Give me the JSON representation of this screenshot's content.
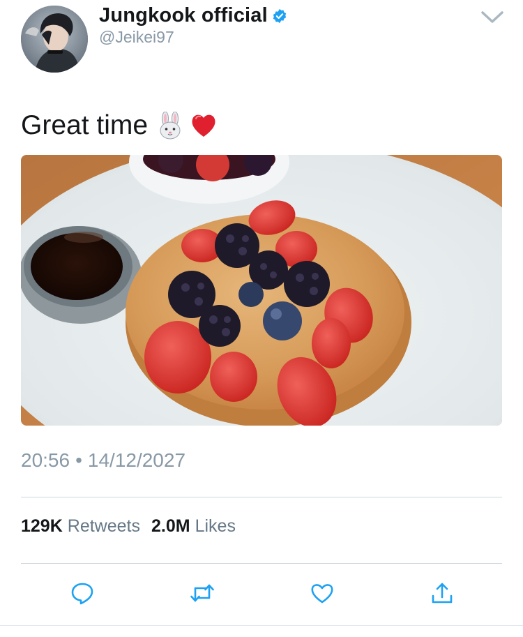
{
  "author": {
    "display_name": "Jungkook official",
    "handle": "@Jeikei97",
    "verified": true,
    "verified_color": "#1da1f2"
  },
  "tweet": {
    "text": "Great time",
    "emojis": [
      "rabbit-face-icon",
      "red-heart-icon"
    ],
    "media_alt": "pancakes with strawberries, blackberries and blueberries, and a cup of syrup on a white plate",
    "time": "20:56",
    "date": "14/12/2027",
    "separator": "•"
  },
  "stats": {
    "retweets_count": "129K",
    "retweets_label": "Retweets",
    "likes_count": "2.0M",
    "likes_label": "Likes"
  },
  "actions": [
    "reply-icon",
    "retweet-icon",
    "like-icon",
    "share-icon"
  ],
  "colors": {
    "text_primary": "#14171a",
    "text_secondary": "#8899a6",
    "icon": "#1da1f2",
    "divider": "#ccd6dd"
  }
}
